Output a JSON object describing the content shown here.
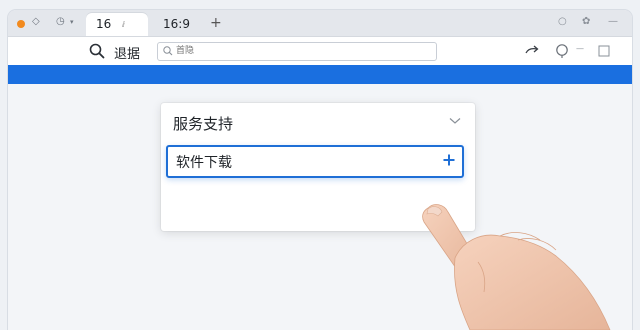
{
  "browser": {
    "tabs": [
      {
        "label": "16",
        "suffix": "ⅈ",
        "active": true
      },
      {
        "label": "16:9",
        "suffix": "",
        "active": false
      }
    ],
    "new_tab_symbol": "+"
  },
  "toolbar": {
    "search_label": "退据",
    "address_placeholder": "首隐"
  },
  "panel": {
    "title": "服务支持",
    "selected_item": "软件下载"
  },
  "colors": {
    "accent_blue": "#1a6fe0",
    "selection_border": "#1f6fd6",
    "tab_dot": "#f28a1e"
  },
  "icons": [
    "search-icon",
    "share-icon",
    "help-icon",
    "window-icon",
    "chevron-down-icon",
    "plus-icon",
    "hand-pointer-icon"
  ]
}
